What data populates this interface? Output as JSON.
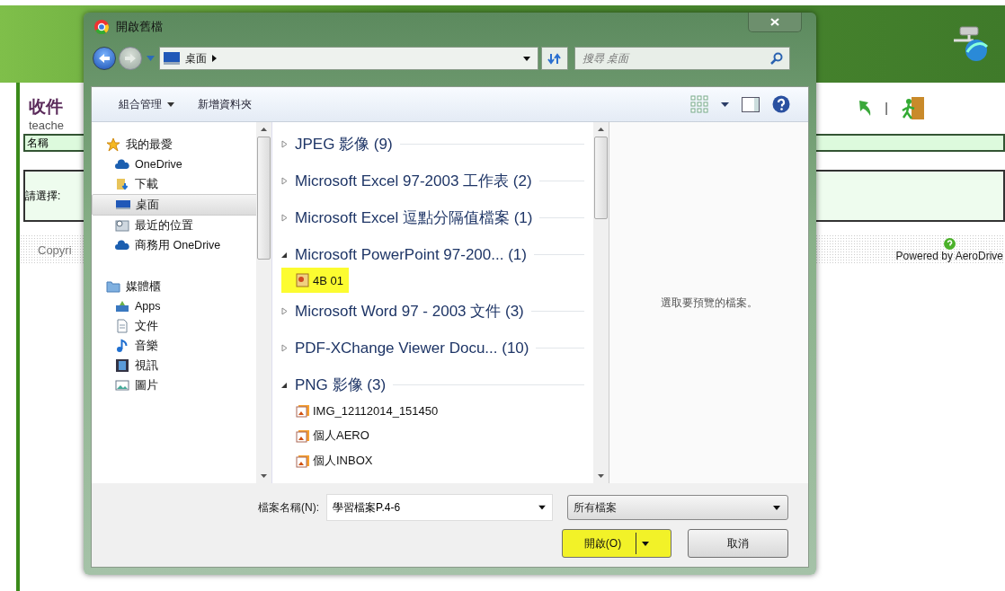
{
  "page": {
    "heading": "收件",
    "user": "teache",
    "name_label": "名稱",
    "select_label": "請選擇:",
    "copyright": "Copyri",
    "separator": "|",
    "powered": "Powered by AeroDrive"
  },
  "dialog": {
    "title": "開啟舊檔",
    "address": {
      "path": "桌面",
      "search_placeholder": "搜尋 桌面"
    },
    "toolbar": {
      "organize": "組合管理",
      "new_folder": "新增資料夾"
    },
    "nav": [
      {
        "label": "我的最愛",
        "kind": "star",
        "selected": false,
        "children": [
          {
            "label": "OneDrive",
            "kind": "cloud",
            "selected": false
          },
          {
            "label": "下載",
            "kind": "download",
            "selected": false
          },
          {
            "label": "桌面",
            "kind": "desktop",
            "selected": true
          },
          {
            "label": "最近的位置",
            "kind": "recent",
            "selected": false
          },
          {
            "label": "商務用 OneDrive",
            "kind": "cloud",
            "selected": false
          }
        ]
      },
      {
        "label": "媒體櫃",
        "kind": "library",
        "selected": false,
        "children": [
          {
            "label": "Apps",
            "kind": "apps",
            "selected": false
          },
          {
            "label": "文件",
            "kind": "document",
            "selected": false
          },
          {
            "label": "音樂",
            "kind": "music",
            "selected": false
          },
          {
            "label": "視訊",
            "kind": "video",
            "selected": false
          },
          {
            "label": "圖片",
            "kind": "picture",
            "selected": false
          }
        ]
      }
    ],
    "groups": [
      {
        "label": "JPEG 影像 (9)",
        "expanded": false
      },
      {
        "label": "Microsoft Excel 97-2003 工作表 (2)",
        "expanded": false
      },
      {
        "label": "Microsoft Excel 逗點分隔值檔案 (1)",
        "expanded": false
      },
      {
        "label": "Microsoft PowerPoint 97-200... (1)",
        "expanded": true,
        "files": [
          {
            "name": "4B 01",
            "kind": "presentation",
            "highlighted": true
          }
        ]
      },
      {
        "label": "Microsoft Word 97 - 2003 文件 (3)",
        "expanded": false
      },
      {
        "label": "PDF-XChange Viewer Docu... (10)",
        "expanded": false
      },
      {
        "label": "PNG 影像 (3)",
        "expanded": true,
        "files": [
          {
            "name": "IMG_12112014_151450",
            "kind": "image",
            "highlighted": false
          },
          {
            "name": "個人AERO",
            "kind": "image",
            "highlighted": false
          },
          {
            "name": "個人INBOX",
            "kind": "image",
            "highlighted": false
          }
        ]
      }
    ],
    "preview": "選取要預覽的檔案。",
    "footer": {
      "filename_label": "檔案名稱(N):",
      "filename": "學習檔案P.4-6",
      "filetype": "所有檔案",
      "open": "開啟(O)",
      "open_highlighted": true,
      "cancel": "取消"
    }
  }
}
